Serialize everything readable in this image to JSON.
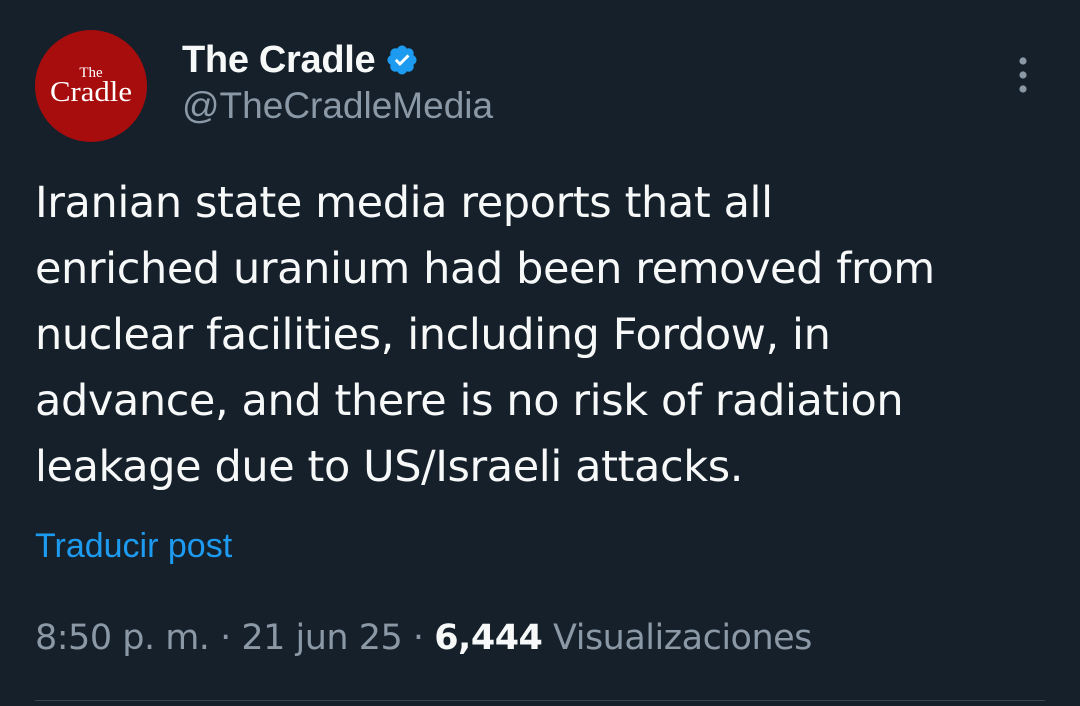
{
  "author": {
    "avatar_text_top": "The",
    "avatar_text_bottom": "Cradle",
    "display_name": "The Cradle",
    "handle": "@TheCradleMedia",
    "verified": true
  },
  "icons": {
    "verified": "verified-badge-icon",
    "more": "more-vertical-icon"
  },
  "tweet": {
    "lines": [
      "Iranian state media reports that all",
      "enriched uranium had been removed from",
      "nuclear facilities, including Fordow, in",
      "advance, and there is no risk of radiation",
      "leakage due to US/Israeli attacks."
    ],
    "translate_label": "Traducir post"
  },
  "meta": {
    "time": "8:50 p. m.",
    "separator": "·",
    "date": "21 jun 25",
    "views_count": "6,444",
    "views_label": "Visualizaciones"
  },
  "colors": {
    "background": "#15202b",
    "text_primary": "#f7f9f9",
    "text_secondary": "#8b98a5",
    "link": "#1d9bf0",
    "avatar_bg": "#a80d0d",
    "divider": "#38444d"
  }
}
